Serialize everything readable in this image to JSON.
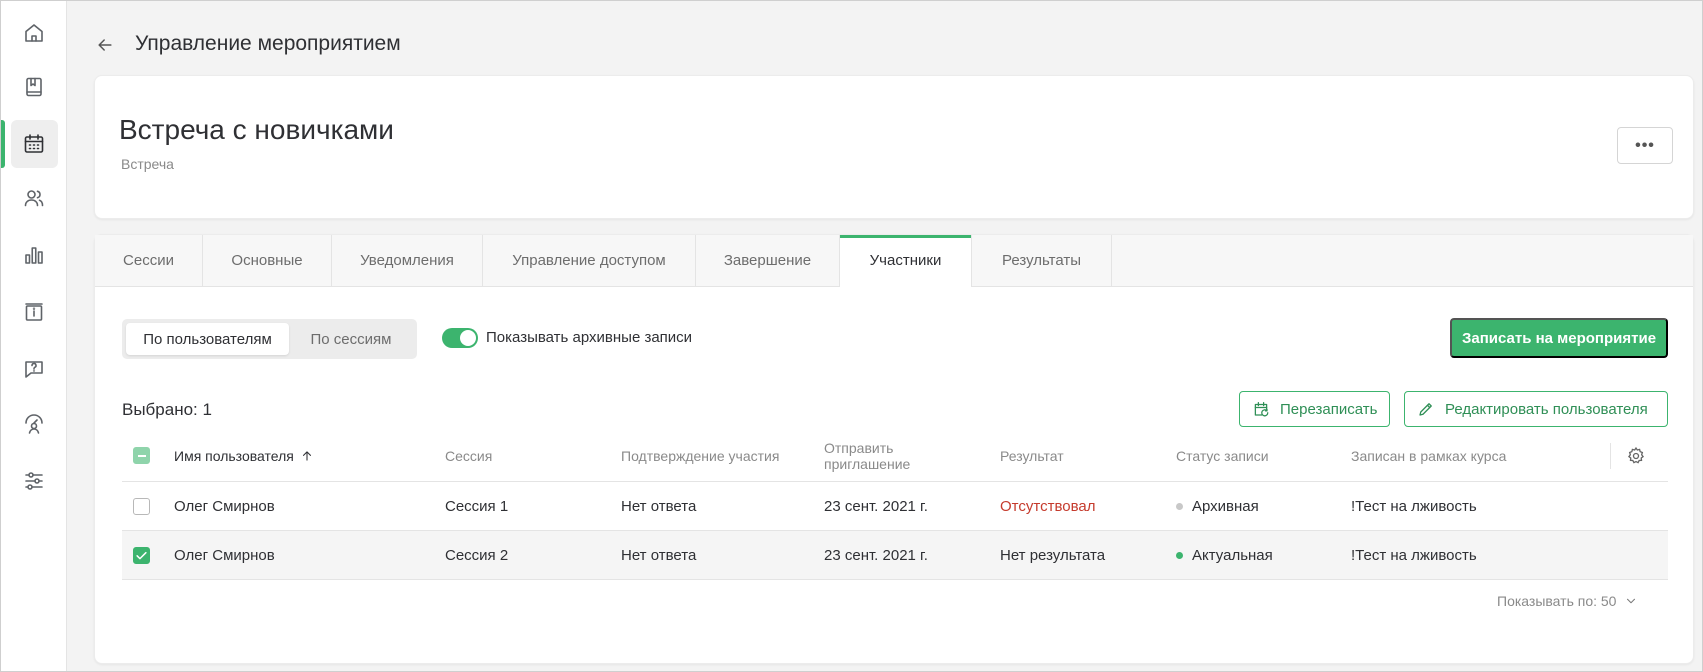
{
  "header": {
    "title": "Управление мероприятием"
  },
  "event": {
    "title": "Встреча с новичками",
    "type": "Встреча",
    "more_label": "•••"
  },
  "sidebar": {
    "items": [
      {
        "icon": "home-icon"
      },
      {
        "icon": "book-icon"
      },
      {
        "icon": "calendar-icon",
        "active": true
      },
      {
        "icon": "users-icon"
      },
      {
        "icon": "chart-icon"
      },
      {
        "icon": "info-box-icon"
      },
      {
        "icon": "question-icon"
      },
      {
        "icon": "user-gauge-icon"
      },
      {
        "icon": "sliders-icon"
      }
    ]
  },
  "tabs": [
    {
      "label": "Сессии"
    },
    {
      "label": "Основные"
    },
    {
      "label": "Уведомления"
    },
    {
      "label": "Управление доступом"
    },
    {
      "label": "Завершение"
    },
    {
      "label": "Участники",
      "active": true
    },
    {
      "label": "Результаты"
    }
  ],
  "view_toggle": {
    "by_users": "По пользователям",
    "by_sessions": "По сессиям"
  },
  "archive_toggle": {
    "label": "Показывать архивные записи",
    "on": true
  },
  "actions": {
    "enroll": "Записать на мероприятие",
    "reenroll": "Перезаписать",
    "edit_user": "Редактировать пользователя"
  },
  "selection": {
    "text": "Выбрано: 1"
  },
  "table": {
    "columns": {
      "user": "Имя пользователя",
      "session": "Сессия",
      "confirmation": "Подтверждение участия",
      "send_invite_1": "Отправить",
      "send_invite_2": "приглашение",
      "result": "Результат",
      "status": "Статус записи",
      "course": "Записан в рамках курса"
    },
    "rows": [
      {
        "user": "Олег Смирнов",
        "session": "Сессия 1",
        "confirmation": "Нет ответа",
        "invite_date": "23 сент. 2021 г.",
        "result": "Отсутствовал",
        "status": "Архивная",
        "course": "!Тест на лживость",
        "checked": false
      },
      {
        "user": "Олег Смирнов",
        "session": "Сессия 2",
        "confirmation": "Нет ответа",
        "invite_date": "23 сент. 2021 г.",
        "result": "Нет результата",
        "status": "Актуальная",
        "course": "!Тест на лживость",
        "checked": true
      }
    ]
  },
  "pager": {
    "label": "Показывать по: 50"
  },
  "colors": {
    "accent": "#3cb46e",
    "error": "#c53b2d",
    "archive_dot": "#c8c8c8",
    "active_dot": "#3cb46e"
  }
}
